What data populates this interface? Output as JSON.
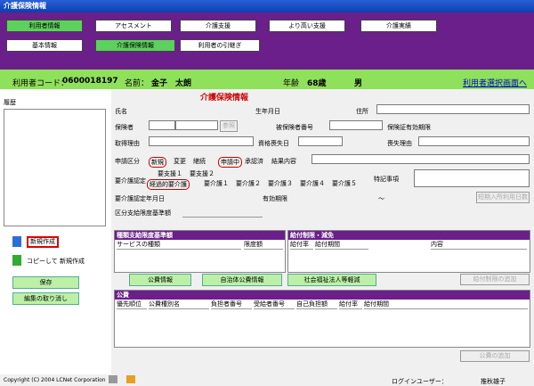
{
  "window": {
    "title": "介護保険情報"
  },
  "tabs_top": [
    {
      "label": "利用者情報",
      "selected": true
    },
    {
      "label": "アセスメント",
      "selected": false
    },
    {
      "label": "介護支援",
      "selected": false
    },
    {
      "label": "より高い支援",
      "selected": false
    },
    {
      "label": "介護実績",
      "selected": false
    }
  ],
  "tabs_sub": [
    {
      "label": "基本情報",
      "selected": false
    },
    {
      "label": "介護保険情報",
      "selected": true
    },
    {
      "label": "利用者の引継ぎ",
      "selected": false
    }
  ],
  "user": {
    "code_label": "利用者コード：",
    "code": "0600018197",
    "name_label": "名前：",
    "name": "金子　太朗",
    "age_label": "年齢",
    "age": "68歳",
    "sex": "男",
    "select_link": "利用者選択画面へ"
  },
  "left": {
    "history_label": "履歴",
    "new_label": "新規作成",
    "copy_new_label": "コピーして 新規作成",
    "save_label": "保存",
    "cancel_label": "編集の取り消し"
  },
  "form": {
    "title": "介護保険情報",
    "name_label": "氏名",
    "birth_label": "生年月日",
    "address_label": "住所",
    "insurer_label": "保険者",
    "ref_button": "参照",
    "insured_no_label": "被保険者番号",
    "validity_label": "保険証有効期限",
    "acq_reason_label": "取得理由",
    "loss_date_label": "資格喪失日",
    "loss_reason_label": "喪失理由",
    "app_class_label": "申請区分",
    "app_options": [
      "新規",
      "変更",
      "継続"
    ],
    "app_status": [
      "申請中",
      "承認済"
    ],
    "result_label": "結果内容",
    "care_cert_label": "要介護認定",
    "support_levels": [
      "要支援１",
      "要支援２"
    ],
    "care_levels": [
      "経過的要介護",
      "要介護１",
      "要介護２",
      "要介護３",
      "要介護４",
      "要介護５"
    ],
    "special_label": "特記事項",
    "cert_date_label": "要介護認定年月日",
    "valid_period_label": "有効期限",
    "tilde": "～",
    "short_stay_button": "短期入所利用日数",
    "limit_label": "区分支給限度基準額"
  },
  "panels": {
    "benefit_title": "種類支給限度基準額",
    "benefit_cols": [
      "サービスの種類",
      "限度額"
    ],
    "limit_title": "給付制限・減免",
    "limit_cols": [
      "給付率",
      "給付期間",
      "内容"
    ],
    "public_info_button": "公費情報",
    "local_public_button": "自治体公費情報",
    "welfare_button": "社会福祉法人等軽減",
    "add_limit_button": "給付制限の追加",
    "public_title": "公費",
    "public_cols": [
      "優先順位",
      "公費種別名",
      "負担者番号",
      "受給者番号",
      "自己負担額",
      "給付率",
      "給付期間"
    ],
    "add_public_button": "公費の追加"
  },
  "footer": {
    "copyright": "Copyright (C) 2004 LCNet Corporation",
    "login_label": "ログインユーザー：",
    "login_user": "推秋雄子"
  }
}
